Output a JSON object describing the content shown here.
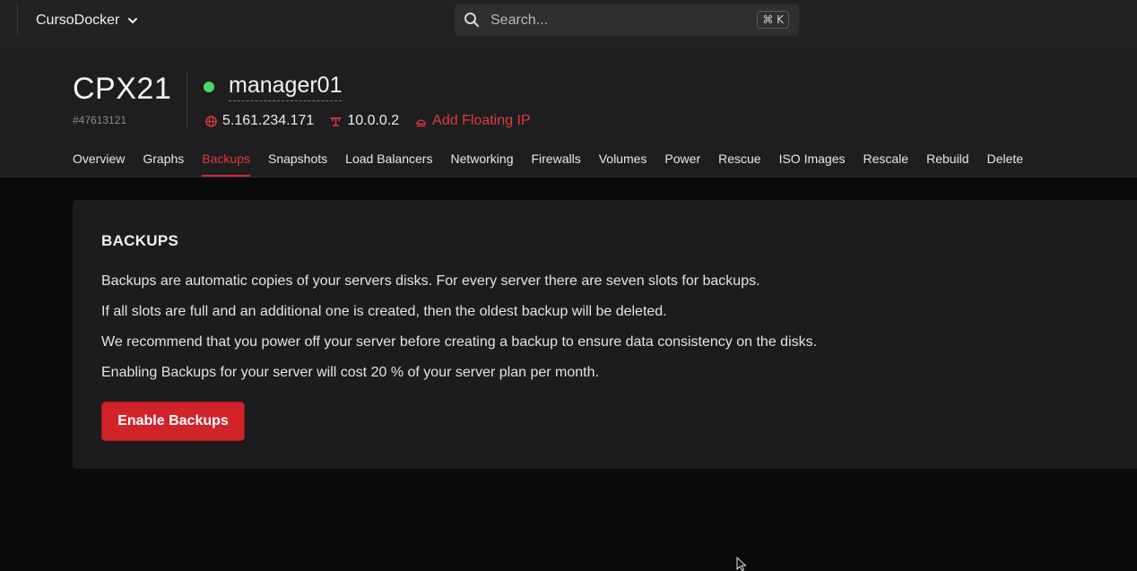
{
  "topbar": {
    "project_name": "CursoDocker",
    "search_placeholder": "Search...",
    "search_shortcut": "⌘ K"
  },
  "server": {
    "plan": "CPX21",
    "id": "#47613121",
    "name": "manager01",
    "status_color": "#4cd964",
    "public_ip": "5.161.234.171",
    "private_ip": "10.0.0.2",
    "add_floating_ip": "Add Floating IP"
  },
  "tabs": [
    {
      "label": "Overview",
      "active": false
    },
    {
      "label": "Graphs",
      "active": false
    },
    {
      "label": "Backups",
      "active": true
    },
    {
      "label": "Snapshots",
      "active": false
    },
    {
      "label": "Load Balancers",
      "active": false
    },
    {
      "label": "Networking",
      "active": false
    },
    {
      "label": "Firewalls",
      "active": false
    },
    {
      "label": "Volumes",
      "active": false
    },
    {
      "label": "Power",
      "active": false
    },
    {
      "label": "Rescue",
      "active": false
    },
    {
      "label": "ISO Images",
      "active": false
    },
    {
      "label": "Rescale",
      "active": false
    },
    {
      "label": "Rebuild",
      "active": false
    },
    {
      "label": "Delete",
      "active": false
    }
  ],
  "backups": {
    "title": "BACKUPS",
    "paragraphs": [
      "Backups are automatic copies of your servers disks. For every server there are seven slots for backups.",
      "If all slots are full and an additional one is created, then the oldest backup will be deleted.",
      "We recommend that you power off your server before creating a backup to ensure data consistency on the disks.",
      "Enabling Backups for your server will cost 20 % of your server plan per month."
    ],
    "enable_button": "Enable Backups"
  },
  "colors": {
    "accent": "#d0232a",
    "active_tab": "#e03a3e"
  }
}
